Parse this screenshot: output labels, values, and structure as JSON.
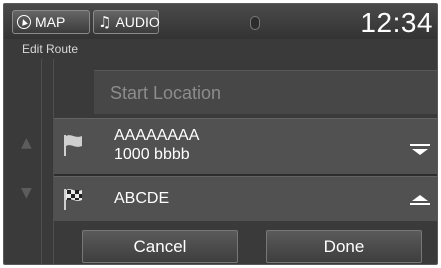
{
  "topbar": {
    "map_label": "MAP",
    "audio_label": "AUDIO",
    "clock": "12:34"
  },
  "header": {
    "title": "Edit Route"
  },
  "route": {
    "start_placeholder": "Start Location",
    "waypoints": [
      {
        "line1": "AAAAAAAA",
        "line2": "1000 bbbb",
        "icon": "waypoint-flag-icon",
        "action": "move-down-icon"
      },
      {
        "line1": "ABCDE",
        "icon": "destination-checkered-flag-icon",
        "action": "move-up-icon"
      }
    ]
  },
  "footer": {
    "cancel_label": "Cancel",
    "done_label": "Done"
  }
}
